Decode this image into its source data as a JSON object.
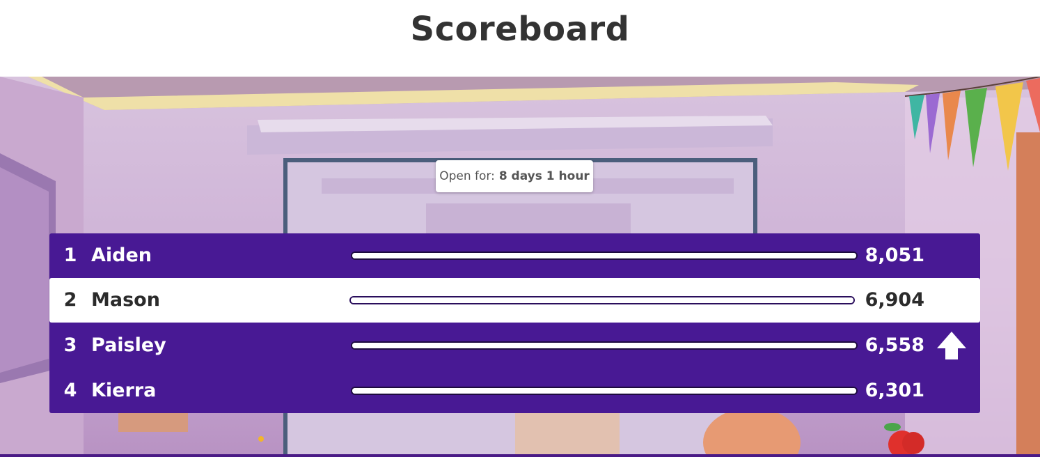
{
  "header": {
    "title": "Scoreboard"
  },
  "timer": {
    "prefix": "Open for:",
    "value": "8 days 1 hour"
  },
  "leaderboard": {
    "rows": [
      {
        "rank": "1",
        "name": "Aiden",
        "score": "8,051",
        "bar_fraction": 1.0,
        "highlighted": false,
        "trend": ""
      },
      {
        "rank": "2",
        "name": "Mason",
        "score": "6,904",
        "bar_fraction": 1.0,
        "highlighted": true,
        "trend": ""
      },
      {
        "rank": "3",
        "name": "Paisley",
        "score": "6,558",
        "bar_fraction": 1.0,
        "highlighted": false,
        "trend": "up-arrow-icon"
      },
      {
        "rank": "4",
        "name": "Kierra",
        "score": "6,301",
        "bar_fraction": 1.0,
        "highlighted": false,
        "trend": ""
      }
    ]
  },
  "colors": {
    "board": "#481994",
    "highlight_row": "#ffffff",
    "title": "#333333"
  }
}
